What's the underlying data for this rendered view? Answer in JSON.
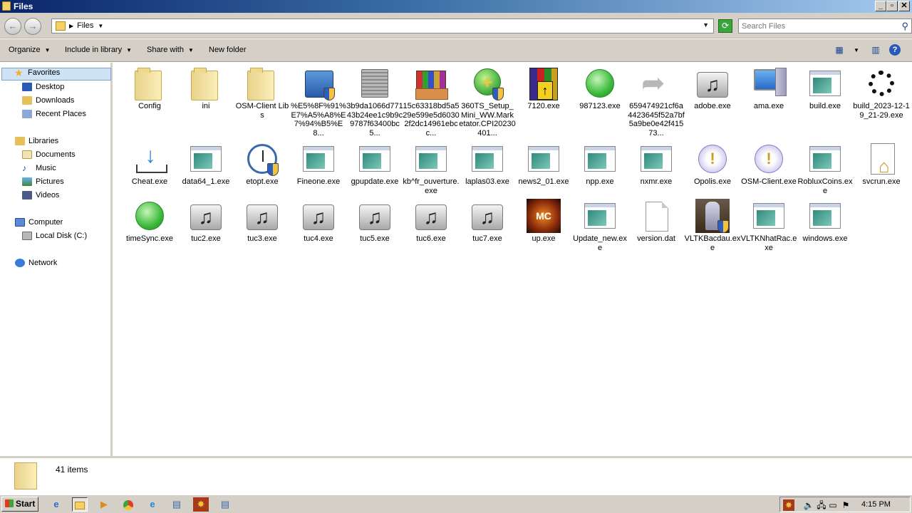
{
  "window": {
    "title": "Files",
    "buttons": {
      "min": "_",
      "max": "▫",
      "close": "✕"
    }
  },
  "address": {
    "crumb": "Files",
    "search_placeholder": "Search Files"
  },
  "toolbar": {
    "organize": "Organize",
    "include": "Include in library",
    "share": "Share with",
    "new_folder": "New folder"
  },
  "sidebar": {
    "favorites": "Favorites",
    "desktop": "Desktop",
    "downloads": "Downloads",
    "recent": "Recent Places",
    "libraries": "Libraries",
    "documents": "Documents",
    "music": "Music",
    "pictures": "Pictures",
    "videos": "Videos",
    "computer": "Computer",
    "localdisk": "Local Disk (C:)",
    "network": "Network"
  },
  "files": [
    {
      "name": "Config",
      "icon": "folder-icon"
    },
    {
      "name": "ini",
      "icon": "folder-icon"
    },
    {
      "name": "OSM-Client Libs",
      "icon": "folder-icon"
    },
    {
      "name": "%E5%8F%91%E7%A5%A8%E7%94%B5%E8...",
      "icon": "folder-shield-icon"
    },
    {
      "name": "3b9da1066d77143b24ee1c9b9c9787f63400bc5...",
      "icon": "gear-icon"
    },
    {
      "name": "15c63318bd5a529e599e5d60302f2dc14961ebcc...",
      "icon": "winrar-box-icon"
    },
    {
      "name": "360TS_Setup_Mini_WW.Marketator.CPI20230401...",
      "icon": "360-shield-icon"
    },
    {
      "name": "7120.exe",
      "icon": "winrar-icon"
    },
    {
      "name": "987123.exe",
      "icon": "green-circle-icon"
    },
    {
      "name": "659474921cf6a4423645f52a7bf5a9be0e42f41573...",
      "icon": "arrow-icon"
    },
    {
      "name": "adobe.exe",
      "icon": "music-icon"
    },
    {
      "name": "ama.exe",
      "icon": "computer-icon"
    },
    {
      "name": "build.exe",
      "icon": "app-icon"
    },
    {
      "name": "build_2023-12-19_21-29.exe",
      "icon": "spinner-icon"
    },
    {
      "name": "Cheat.exe",
      "icon": "download-icon"
    },
    {
      "name": "data64_1.exe",
      "icon": "app-icon"
    },
    {
      "name": "etopt.exe",
      "icon": "clock-icon"
    },
    {
      "name": "Fineone.exe",
      "icon": "app-icon"
    },
    {
      "name": "gpupdate.exe",
      "icon": "app-icon"
    },
    {
      "name": "kb^fr_ouverture.exe",
      "icon": "app-icon"
    },
    {
      "name": "laplas03.exe",
      "icon": "app-icon"
    },
    {
      "name": "news2_01.exe",
      "icon": "app-icon"
    },
    {
      "name": "npp.exe",
      "icon": "app-icon"
    },
    {
      "name": "nxmr.exe",
      "icon": "app-icon"
    },
    {
      "name": "Opolis.exe",
      "icon": "warning-icon"
    },
    {
      "name": "OSM-Client.exe",
      "icon": "warning-icon"
    },
    {
      "name": "RobluxCoins.exe",
      "icon": "app-icon"
    },
    {
      "name": "svcrun.exe",
      "icon": "house-doc-icon"
    },
    {
      "name": "timeSync.exe",
      "icon": "green-circle-icon"
    },
    {
      "name": "tuc2.exe",
      "icon": "music-icon"
    },
    {
      "name": "tuc3.exe",
      "icon": "music-icon"
    },
    {
      "name": "tuc4.exe",
      "icon": "music-icon"
    },
    {
      "name": "tuc5.exe",
      "icon": "music-icon"
    },
    {
      "name": "tuc6.exe",
      "icon": "music-icon"
    },
    {
      "name": "tuc7.exe",
      "icon": "music-icon"
    },
    {
      "name": "up.exe",
      "icon": "game-logo-icon"
    },
    {
      "name": "Update_new.exe",
      "icon": "app-icon"
    },
    {
      "name": "version.dat",
      "icon": "document-icon"
    },
    {
      "name": "VLTKBacdau.exe",
      "icon": "knight-icon"
    },
    {
      "name": "VLTKNhatRac.exe",
      "icon": "app-icon"
    },
    {
      "name": "windows.exe",
      "icon": "app-icon"
    }
  ],
  "status": {
    "count": "41 items"
  },
  "taskbar": {
    "start": "Start",
    "time": "4:15 PM"
  }
}
